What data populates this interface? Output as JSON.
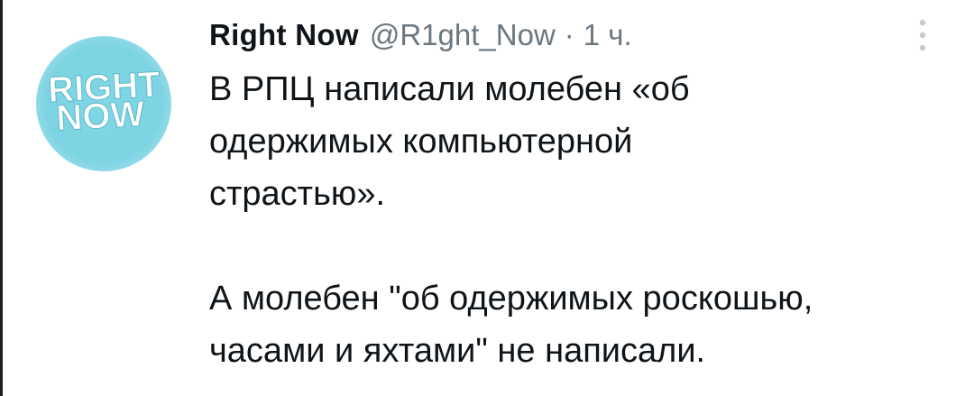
{
  "author": {
    "display_name": "Right Now",
    "handle": "@R1ght_Now",
    "separator": "·",
    "time": "1 ч.",
    "avatar_text": [
      "RIGHT",
      "NOW"
    ]
  },
  "icons": {
    "more": "more-vertical-icon"
  },
  "tweet": {
    "text": "В РПЦ написали молебен «об\nодержимых компьютерной\nстрастью».\n\nА молебен \"об одержимых роскошью,\nчасами и яхтами\" не написали."
  },
  "colors": {
    "avatar_bg": "#7dd3e2",
    "secondary_text": "#6b7780",
    "primary_text": "#0f1419"
  }
}
